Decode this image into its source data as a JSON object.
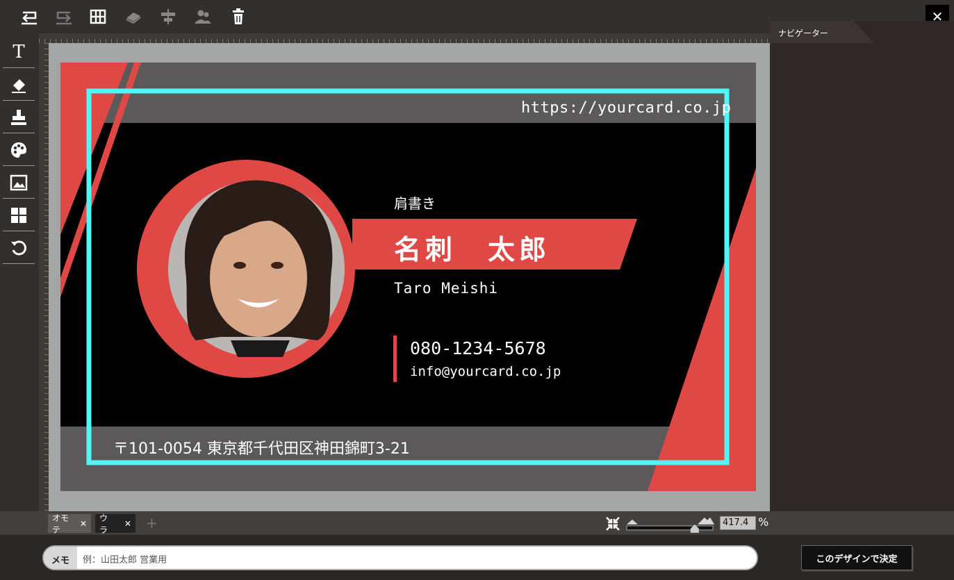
{
  "toolbar": {
    "icons": [
      "undo-icon",
      "redo-icon",
      "grid-icon",
      "layer-icon",
      "align-icon",
      "group-icon",
      "trash-icon"
    ],
    "close_label": "✕"
  },
  "left_tools": [
    "text-tool-icon",
    "eraser-icon",
    "stamp-icon",
    "palette-icon",
    "image-icon",
    "template-icon",
    "reset-icon"
  ],
  "left_tools_text_glyph": "T",
  "navigator": {
    "title": "ナビゲーター"
  },
  "card": {
    "url": "https://yourcard.co.jp",
    "title_small": "肩書き",
    "name_jp": "名刺　太郎",
    "name_en": "Taro Meishi",
    "phone": "080-1234-5678",
    "email": "info@yourcard.co.jp",
    "address": "〒101-0054 東京都千代田区神田錦町3-21",
    "colors": {
      "accent": "#e04845",
      "frame": "#52f5f5",
      "dark": "#000000",
      "band": "#5b5959"
    }
  },
  "pages": {
    "front_label": "オモテ",
    "back_label": "ウラ",
    "close_glyph": "✕",
    "add_glyph": "+"
  },
  "zoom": {
    "value": "417.4",
    "unit": "%",
    "level": 0.82
  },
  "memo": {
    "label": "メモ",
    "placeholder": "例：山田太郎 営業用"
  },
  "decide_button": "このデザインで決定"
}
